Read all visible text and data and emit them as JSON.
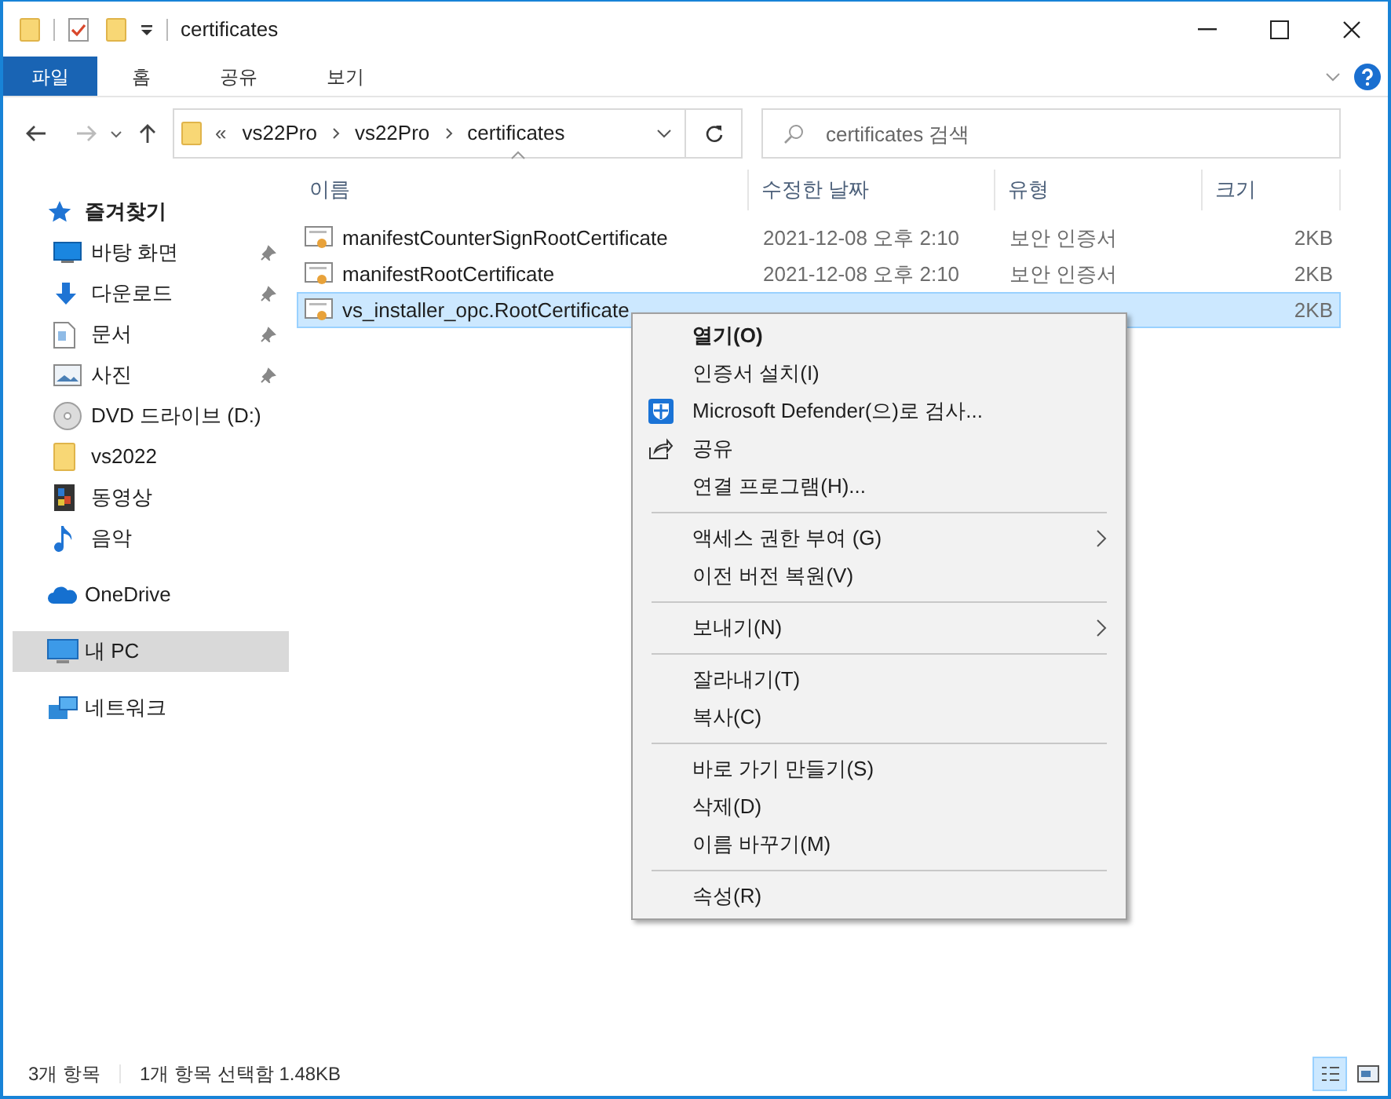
{
  "window": {
    "title": "certificates"
  },
  "ribbon": {
    "file_tab": "파일",
    "tabs": [
      "홈",
      "공유",
      "보기"
    ]
  },
  "address": {
    "overflow": "«",
    "crumbs": [
      "vs22Pro",
      "vs22Pro",
      "certificates"
    ]
  },
  "search": {
    "placeholder": "certificates 검색"
  },
  "sidebar": {
    "items": [
      {
        "kind": "star",
        "label": "즐겨찾기",
        "selected": false,
        "children": [
          {
            "kind": "desktop",
            "label": "바탕 화면",
            "pinned": true,
            "selected": false
          },
          {
            "kind": "download",
            "label": "다운로드",
            "pinned": true,
            "selected": false
          },
          {
            "kind": "document",
            "label": "문서",
            "pinned": true,
            "selected": false
          },
          {
            "kind": "pictures",
            "label": "사진",
            "pinned": true,
            "selected": false
          },
          {
            "kind": "dvd",
            "label": "DVD 드라이브 (D:)",
            "pinned": false,
            "selected": false
          },
          {
            "kind": "folder",
            "label": "vs2022",
            "pinned": false,
            "selected": false
          },
          {
            "kind": "video",
            "label": "동영상",
            "pinned": false,
            "selected": false
          },
          {
            "kind": "music",
            "label": "음악",
            "pinned": false,
            "selected": false
          }
        ]
      },
      {
        "kind": "cloud",
        "label": "OneDrive",
        "selected": false
      },
      {
        "kind": "pc",
        "label": "내 PC",
        "selected": true
      },
      {
        "kind": "network",
        "label": "네트워크",
        "selected": false
      }
    ]
  },
  "table": {
    "columns": [
      {
        "label": "이름",
        "sorted": true
      },
      {
        "label": "수정한 날짜",
        "sorted": false
      },
      {
        "label": "유형",
        "sorted": false
      },
      {
        "label": "크기",
        "sorted": false
      }
    ],
    "rows": [
      {
        "name": "manifestCounterSignRootCertificate",
        "date": "2021-12-08 오후 2:10",
        "type": "보안 인증서",
        "size": "2KB",
        "selected": false
      },
      {
        "name": "manifestRootCertificate",
        "date": "2021-12-08 오후 2:10",
        "type": "보안 인증서",
        "size": "2KB",
        "selected": false
      },
      {
        "name": "vs_installer_opc.RootCertificate",
        "size": "2KB",
        "selected": true
      }
    ]
  },
  "context_menu": {
    "items": [
      {
        "kind": "item",
        "label": "열기(O)",
        "default": true
      },
      {
        "kind": "item",
        "label": "인증서 설치(I)"
      },
      {
        "kind": "defender",
        "label": "Microsoft Defender(으)로 검사..."
      },
      {
        "kind": "share",
        "label": "공유"
      },
      {
        "kind": "item",
        "label": "연결 프로그램(H)..."
      },
      {
        "kind": "separator"
      },
      {
        "kind": "item",
        "label": "액세스 권한 부여 (G)",
        "submenu": true
      },
      {
        "kind": "item",
        "label": "이전 버전 복원(V)"
      },
      {
        "kind": "separator"
      },
      {
        "kind": "item",
        "label": "보내기(N)",
        "submenu": true
      },
      {
        "kind": "separator"
      },
      {
        "kind": "item",
        "label": "잘라내기(T)"
      },
      {
        "kind": "item",
        "label": "복사(C)"
      },
      {
        "kind": "separator"
      },
      {
        "kind": "item",
        "label": "바로 가기 만들기(S)"
      },
      {
        "kind": "item",
        "label": "삭제(D)"
      },
      {
        "kind": "item",
        "label": "이름 바꾸기(M)"
      },
      {
        "kind": "separator"
      },
      {
        "kind": "item",
        "label": "속성(R)"
      }
    ]
  },
  "status_bar": {
    "count": "3개 항목",
    "selection": "1개 항목 선택함 1.48KB",
    "views": [
      {
        "selected": true
      },
      {
        "selected": false
      }
    ]
  }
}
